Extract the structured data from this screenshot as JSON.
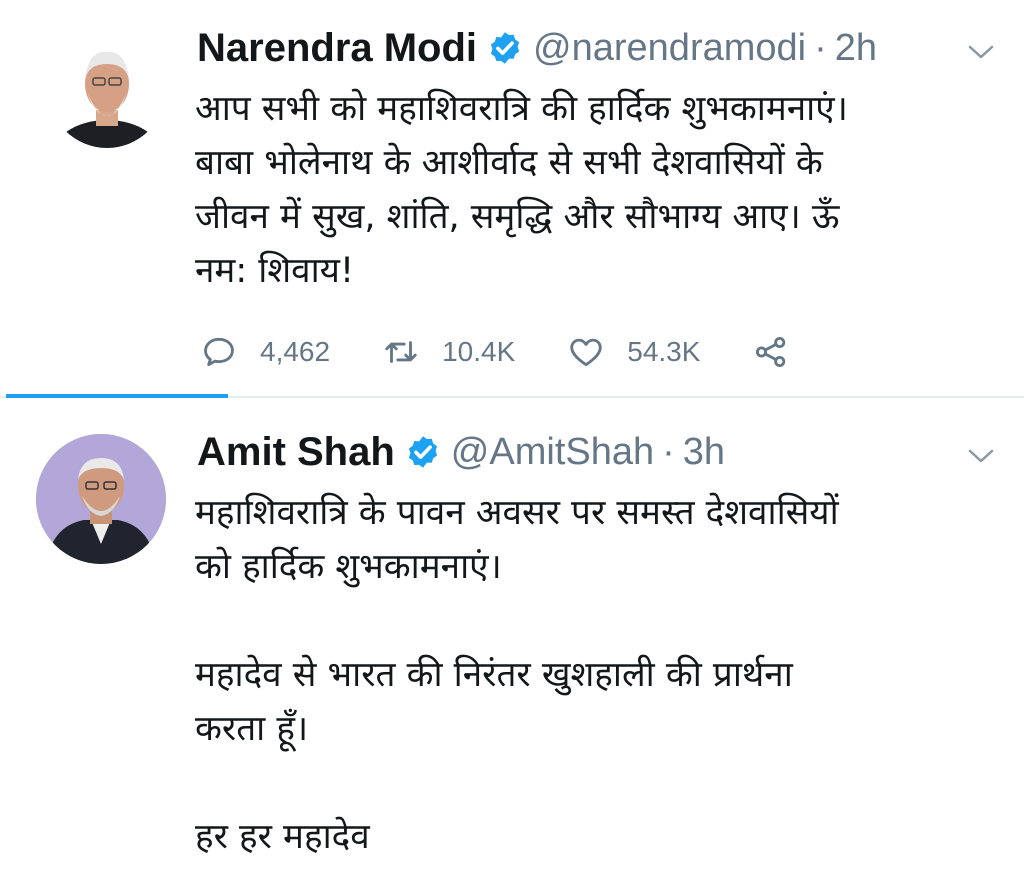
{
  "tweets": [
    {
      "name": "Narendra Modi",
      "handle": "@narendramodi",
      "separator": "·",
      "time": "2h",
      "lines": [
        "आप सभी को महाशिवरात्रि की हार्दिक शुभकामनाएं।",
        "बाबा भोलेनाथ के आशीर्वाद से सभी देशवासियों के",
        "जीवन में सुख, शांति, समृद्धि और सौभाग्य आए। ऊँ",
        "नम: शिवाय!"
      ],
      "replies": "4,462",
      "retweets": "10.4K",
      "likes": "54.3K"
    },
    {
      "name": "Amit Shah",
      "handle": "@AmitShah",
      "separator": "·",
      "time": "3h",
      "lines": [
        "महाशिवरात्रि के पावन अवसर पर समस्त देशवासियों",
        "को हार्दिक शुभकामनाएं।",
        "",
        "महादेव से भारत की निरंतर खुशहाली की प्रार्थना",
        "करता हूँ।",
        "",
        "हर हर महादेव"
      ]
    }
  ],
  "icons": {
    "verified": "verified-badge-icon",
    "reply": "reply-icon",
    "retweet": "retweet-icon",
    "like": "heart-icon",
    "share": "share-icon",
    "more": "chevron-down-icon"
  },
  "colors": {
    "accent": "#1da1f2",
    "muted": "#657786",
    "text": "#14171a"
  }
}
